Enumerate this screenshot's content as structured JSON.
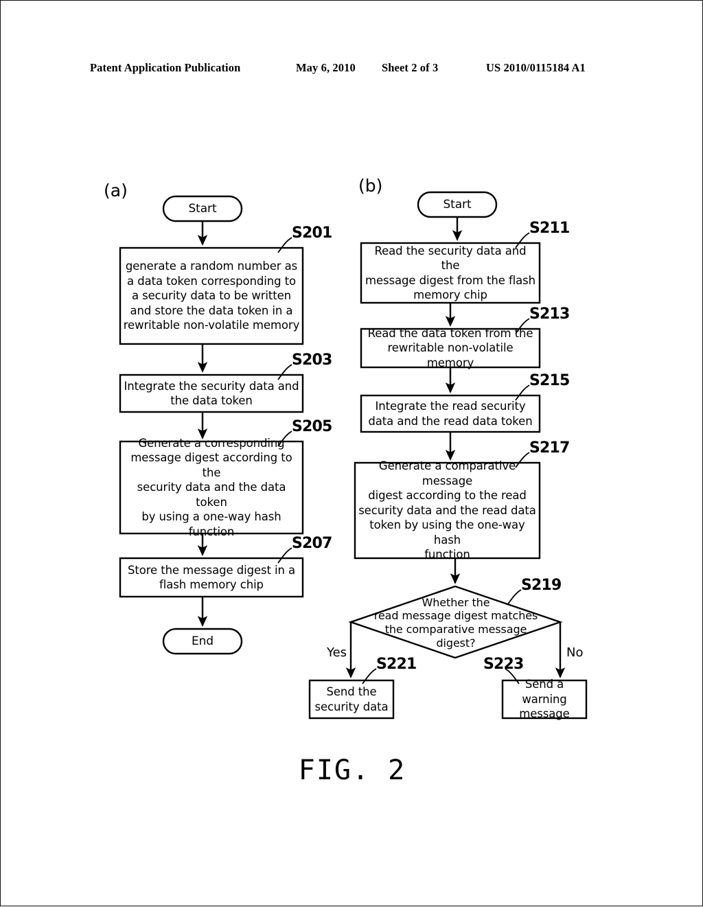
{
  "header": {
    "publication": "Patent Application Publication",
    "date": "May 6, 2010",
    "sheet": "Sheet 2 of 3",
    "patent_number": "US 2010/0115184 A1"
  },
  "figure": {
    "caption": "FIG. 2",
    "panels": [
      {
        "id": "a",
        "label": "(a)"
      },
      {
        "id": "b",
        "label": "(b)"
      }
    ]
  },
  "flowchart_a": {
    "start": "Start",
    "end": "End",
    "steps": [
      {
        "ref": "S201",
        "text": "generate a random number as\na data token corresponding to\na security data to be written\nand store the data token in a\nrewritable non-volatile memory"
      },
      {
        "ref": "S203",
        "text": "Integrate the security data and\nthe data token"
      },
      {
        "ref": "S205",
        "text": "Generate a corresponding\nmessage digest according to the\nsecurity data and the data token\nby using a one-way hash\nfunction"
      },
      {
        "ref": "S207",
        "text": "Store the message digest in a\nflash memory chip"
      }
    ]
  },
  "flowchart_b": {
    "start": "Start",
    "steps": [
      {
        "ref": "S211",
        "text": "Read the security data and the\nmessage digest from the flash\nmemory chip"
      },
      {
        "ref": "S213",
        "text": "Read the data token from the\nrewritable non-volatile memory"
      },
      {
        "ref": "S215",
        "text": "Integrate the read security\ndata and the read data token"
      },
      {
        "ref": "S217",
        "text": "Generate a comparative message\ndigest according to the read\nsecurity data and the read data\ntoken by using the one-way hash\nfunction"
      }
    ],
    "decision": {
      "ref": "S219",
      "text": "Whether the\nread message digest matches\nthe comparative message\ndigest?",
      "yes_label": "Yes",
      "no_label": "No"
    },
    "outcomes": [
      {
        "ref": "S221",
        "text": "Send the\nsecurity data"
      },
      {
        "ref": "S223",
        "text": "Send a warning\nmessage"
      }
    ]
  },
  "colors": {
    "ink": "#000000",
    "paper": "#ffffff"
  }
}
